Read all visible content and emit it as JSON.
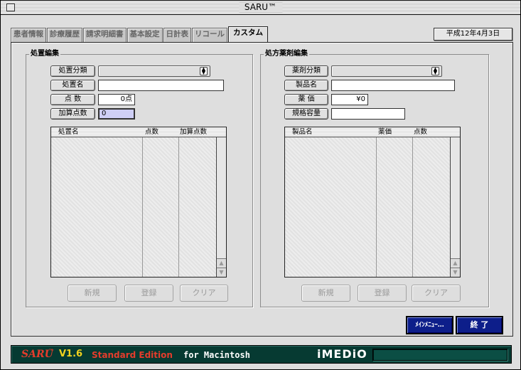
{
  "window": {
    "title": "SARU™"
  },
  "tabs": [
    {
      "label": "患者情報"
    },
    {
      "label": "診療履歴"
    },
    {
      "label": "請求明細書"
    },
    {
      "label": "基本設定"
    },
    {
      "label": "日計表"
    },
    {
      "label": "リコール"
    },
    {
      "label": "カスタム",
      "active": true
    }
  ],
  "date": "平成12年4月3日",
  "procedure": {
    "title": "処置編集",
    "category_label": "処置分類",
    "category_value": "",
    "name_label": "処置名",
    "name_value": "",
    "points_label": "点 数",
    "points_value": "0点",
    "extra_points_label": "加算点数",
    "extra_points_value": "0",
    "columns": [
      "処置名",
      "点数",
      "加算点数"
    ],
    "rows": [],
    "buttons": {
      "new": "新規",
      "register": "登録",
      "clear": "クリア"
    }
  },
  "prescription": {
    "title": "処方薬剤編集",
    "category_label": "薬剤分類",
    "category_value": "",
    "name_label": "製品名",
    "name_value": "",
    "price_label": "薬 価",
    "price_value": "¥0",
    "spec_label": "規格容量",
    "spec_value": "",
    "columns": [
      "製品名",
      "薬価",
      "点数"
    ],
    "rows": [],
    "buttons": {
      "new": "新規",
      "register": "登録",
      "clear": "クリア"
    }
  },
  "actions": {
    "main_menu": "ﾒｲﾝﾒﾆｭｰ…",
    "quit": "終 了"
  },
  "footer": {
    "product": "SARU",
    "tm": "™",
    "version": "V1.6",
    "edition": "Standard Edition",
    "platform": "for Macintosh",
    "brand": "iMEDiO"
  },
  "colors": {
    "navy": "#0d1e8a",
    "footer_bg": "#063a32",
    "brand_red": "#e53c2c",
    "version_yellow": "#f2d21e"
  }
}
